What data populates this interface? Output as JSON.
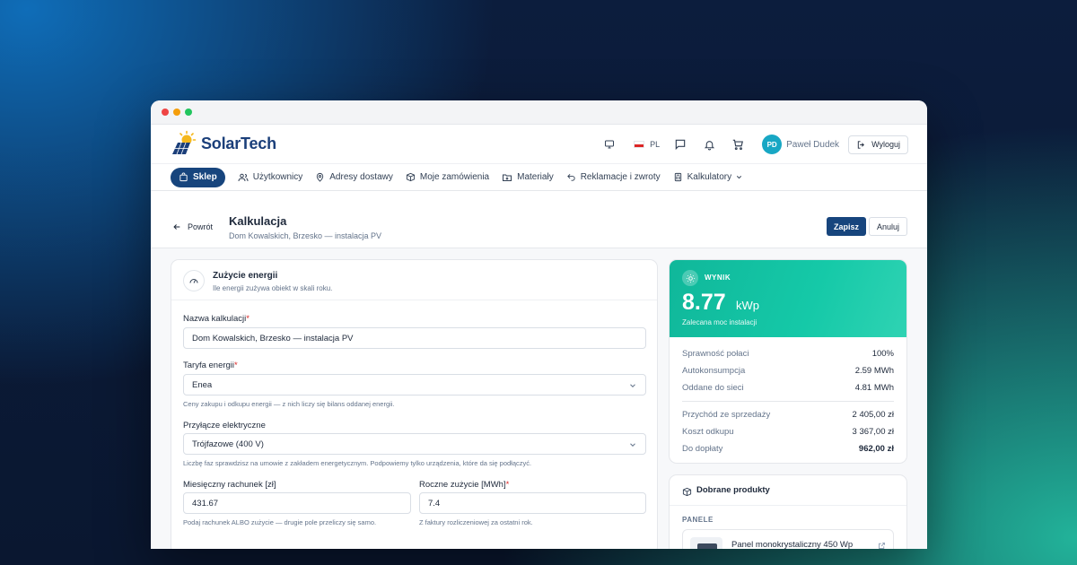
{
  "brand": {
    "name": "SolarTech"
  },
  "header": {
    "lang": "PL",
    "avatar_initials": "PD",
    "user_name": "Paweł Dudek",
    "logout_label": "Wyloguj"
  },
  "nav": {
    "items": [
      {
        "label": "Sklep",
        "icon": "bag-icon"
      },
      {
        "label": "Użytkownicy",
        "icon": "users-icon"
      },
      {
        "label": "Adresy dostawy",
        "icon": "pin-icon"
      },
      {
        "label": "Moje zamówienia",
        "icon": "box-icon"
      },
      {
        "label": "Materiały",
        "icon": "folder-icon"
      },
      {
        "label": "Reklamacje i zwroty",
        "icon": "undo-icon"
      },
      {
        "label": "Kalkulatory",
        "icon": "calculator-icon"
      }
    ]
  },
  "page": {
    "back_label": "Powrót",
    "title": "Kalkulacja",
    "subtitle": "Dom Kowalskich, Brzesko — instalacja PV",
    "save_label": "Zapisz",
    "cancel_label": "Anuluj"
  },
  "energy": {
    "title": "Zużycie energii",
    "description": "Ile energii zużywa obiekt w skali roku.",
    "name_label": "Nazwa kalkulacji",
    "name_value": "Dom Kowalskich, Brzesko — instalacja PV",
    "tariff_label": "Taryfa energii",
    "tariff_value": "Enea",
    "tariff_hint": "Ceny zakupu i odkupu energii — z nich liczy się bilans oddanej energii.",
    "connection_label": "Przyłącze elektryczne",
    "connection_value": "Trójfazowe (400 V)",
    "connection_hint": "Liczbę faz sprawdzisz na umowie z zakładem energetycznym. Podpowiemy tylko urządzenia, które da się podłączyć.",
    "bill_label": "Miesięczny rachunek [zł]",
    "bill_value": "431.67",
    "bill_hint": "Podaj rachunek ALBO zużycie — drugie pole przeliczy się samo.",
    "usage_label": "Roczne zużycie [MWh]",
    "usage_value": "7.4",
    "usage_hint": "Z faktury rozliczeniowej za ostatni rok."
  },
  "result": {
    "badge": "WYNIK",
    "value": "8.77",
    "unit": "kWp",
    "caption": "Zalecana moc instalacji",
    "rows_a": [
      {
        "label": "Sprawność połaci",
        "value": "100%"
      },
      {
        "label": "Autokonsumpcja",
        "value": "2.59 MWh"
      },
      {
        "label": "Oddane do sieci",
        "value": "4.81 MWh"
      }
    ],
    "rows_b": [
      {
        "label": "Przychód ze sprzedaży",
        "value": "2 405,00 zł"
      },
      {
        "label": "Koszt odkupu",
        "value": "3 367,00 zł"
      },
      {
        "label": "Do dopłaty",
        "value": "962,00 zł"
      }
    ]
  },
  "products": {
    "title": "Dobrane produkty",
    "category": "PANELE",
    "item_name": "Panel monokrystaliczny 450 Wp"
  },
  "colors": {
    "primary": "#17457d",
    "accent": "#15c9a8",
    "avatar": "#18a7c4",
    "required": "#dc2626"
  }
}
